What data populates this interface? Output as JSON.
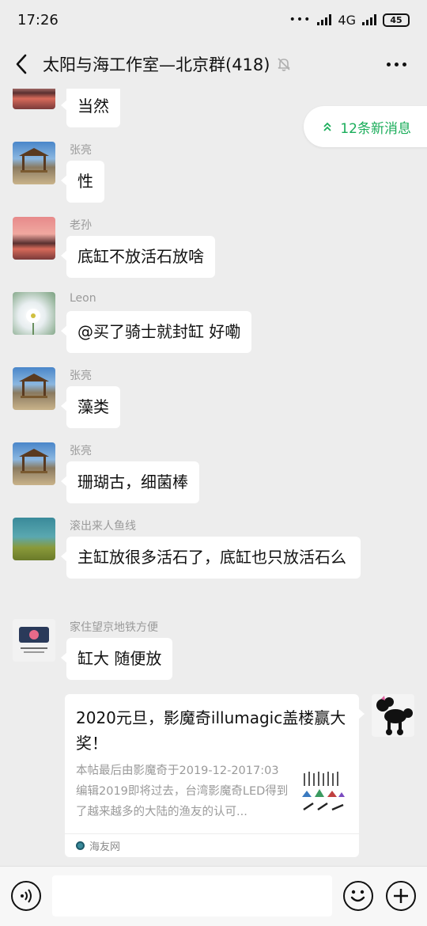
{
  "status_bar": {
    "time": "17:26",
    "dots": "•••",
    "network": "4G",
    "battery": "45"
  },
  "header": {
    "title": "太阳与海工作室—北京群(418)"
  },
  "new_messages": {
    "label": "12条新消息"
  },
  "messages": [
    {
      "sender": "",
      "text": "当然",
      "avatar": "sunset-avatar"
    },
    {
      "sender": "张亮",
      "text": "性",
      "avatar": "pavilion-avatar"
    },
    {
      "sender": "老孙",
      "text": "底缸不放活石放啥",
      "avatar": "sunset-avatar"
    },
    {
      "sender": "Leon",
      "text": "@买了骑士就封缸 好嘞",
      "avatar": "daisy-avatar"
    },
    {
      "sender": "张亮",
      "text": "藻类",
      "avatar": "pavilion-avatar"
    },
    {
      "sender": "张亮",
      "text": "珊瑚古，细菌棒",
      "avatar": "pavilion-avatar"
    },
    {
      "sender": "滚出来人鱼线",
      "text": "主缸放很多活石了，底缸也只放活石么",
      "avatar": "reef-avatar"
    },
    {
      "sender": "家住望京地铁方便",
      "text": "缸大 随便放",
      "avatar": "logo-avatar"
    }
  ],
  "link_card": {
    "title": "2020元旦，影魔奇illumagic盖楼赢大奖！",
    "description": "本帖最后由影魔奇于2019-12-2017:03编辑2019即将过去，台湾影魔奇LED得到了越来越多的大陆的渔友的认可...",
    "source": "海友网"
  },
  "colors": {
    "accent_green": "#1aad5a",
    "background": "#ededed",
    "bubble": "#ffffff"
  }
}
